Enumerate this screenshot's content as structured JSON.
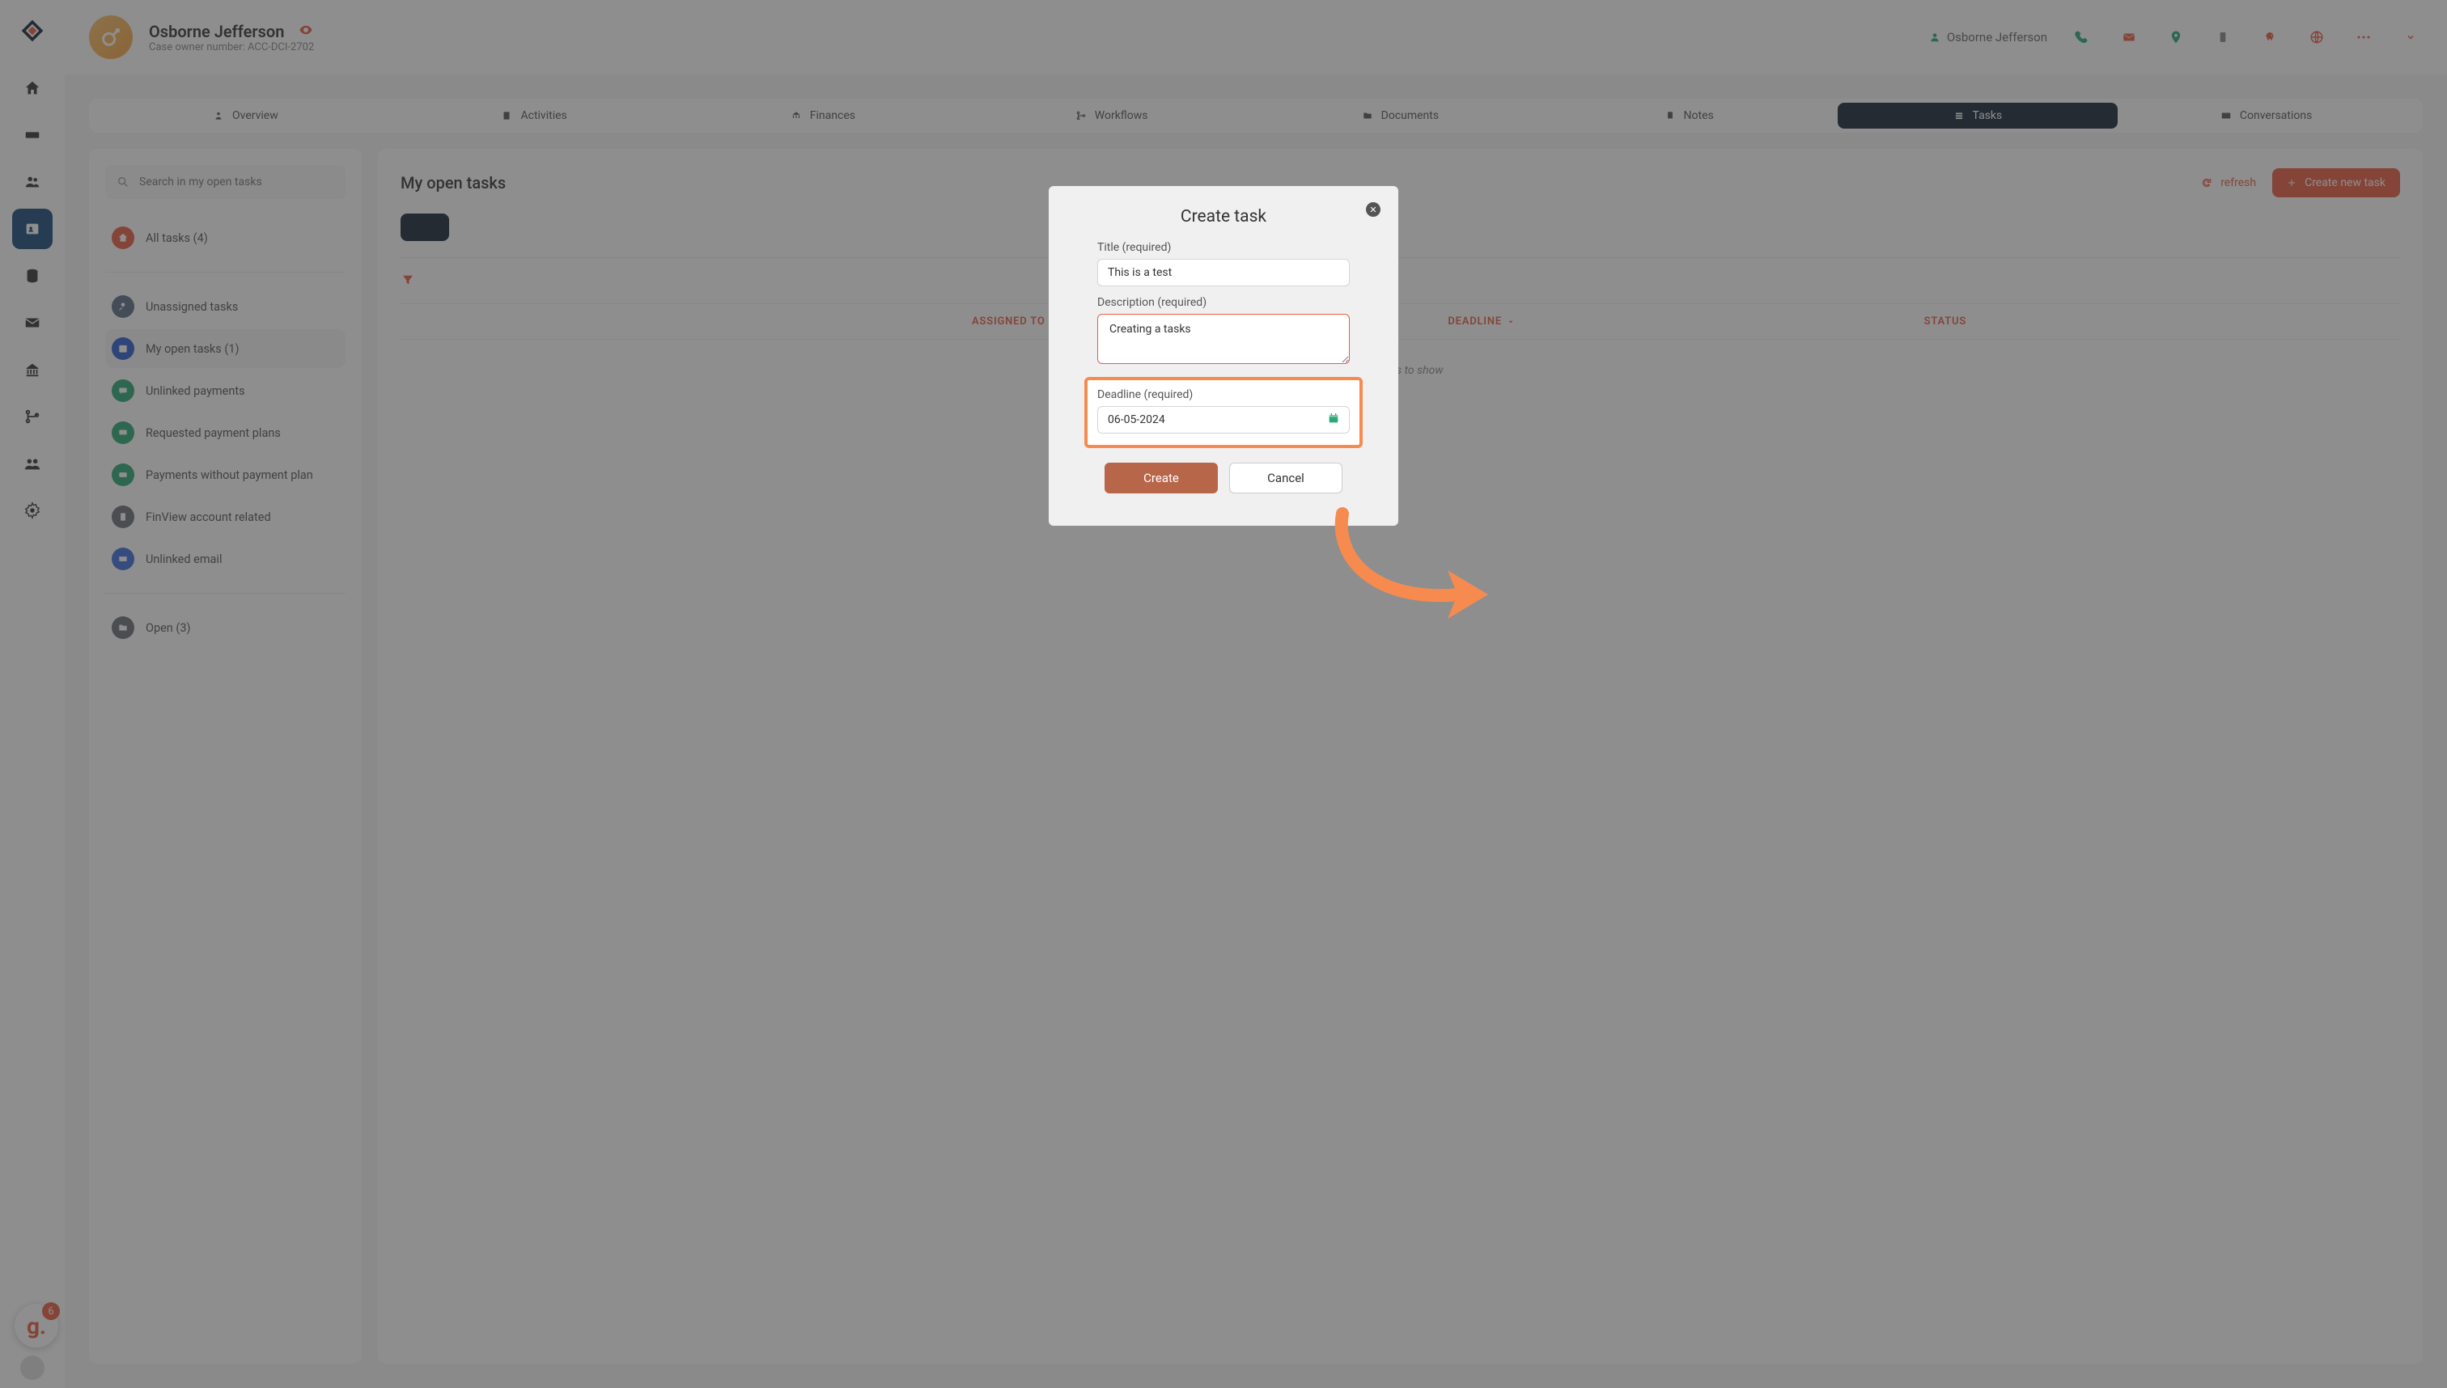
{
  "header": {
    "user_name": "Osborne Jefferson",
    "case_owner_label": "Case owner number: ACC-DCI-2702",
    "right_user": "Osborne Jefferson"
  },
  "nav_badge_count": "6",
  "tabs": {
    "overview": "Overview",
    "activities": "Activities",
    "finances": "Finances",
    "workflows": "Workflows",
    "documents": "Documents",
    "notes": "Notes",
    "tasks": "Tasks",
    "conversations": "Conversations"
  },
  "sidebar": {
    "search_placeholder": "Search in my open tasks",
    "items": [
      {
        "label": "All tasks (4)",
        "color": "#e85c41"
      },
      {
        "label": "Unassigned tasks",
        "color": "#5b6e86"
      },
      {
        "label": "My open tasks (1)",
        "color": "#2a5dd1"
      },
      {
        "label": "Unlinked payments",
        "color": "#2aa876"
      },
      {
        "label": "Requested payment plans",
        "color": "#2aa876"
      },
      {
        "label": "Payments without payment plan",
        "color": "#2aa876"
      },
      {
        "label": "FinView account related",
        "color": "#6a6f77"
      },
      {
        "label": "Unlinked email",
        "color": "#3b6fdc"
      },
      {
        "label": "Open (3)",
        "color": "#6a6f77"
      }
    ]
  },
  "panel": {
    "title": "My open tasks",
    "refresh": "refresh",
    "create_new": "Create new task",
    "columns": {
      "assigned": "ASSIGNED TO",
      "deadline": "DEADLINE",
      "status": "STATUS"
    },
    "empty": "No items to show"
  },
  "modal": {
    "title": "Create task",
    "title_label": "Title (required)",
    "title_value": "This is a test",
    "desc_label": "Description (required)",
    "desc_value": "Creating a tasks",
    "deadline_label": "Deadline (required)",
    "deadline_value": "06-05-2024",
    "create": "Create",
    "cancel": "Cancel"
  }
}
